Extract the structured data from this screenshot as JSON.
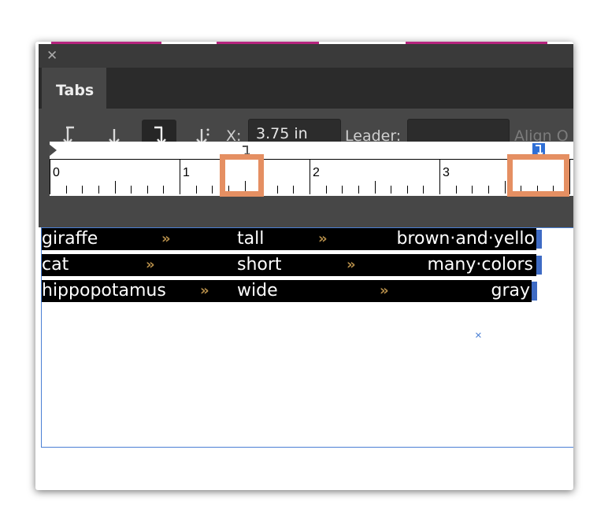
{
  "panel": {
    "title_tab": "Tabs",
    "close_icon": "close-icon",
    "toolbar": {
      "buttons": [
        {
          "name": "left-justified-tab-icon",
          "glyph": "↓"
        },
        {
          "name": "center-justified-tab-icon",
          "glyph": "↓"
        },
        {
          "name": "right-justified-tab-icon",
          "glyph": "↓"
        },
        {
          "name": "align-to-decimal-tab-icon",
          "glyph": "↓"
        }
      ],
      "x_label": "X:",
      "x_value": "3.75 in",
      "leader_label": "Leader:",
      "leader_value": "",
      "align_label": "Align O"
    },
    "ruler": {
      "numbers": [
        "0",
        "1",
        "2",
        "3"
      ]
    }
  },
  "document": {
    "rows": [
      {
        "col1": "giraffe",
        "col2": "tall",
        "col3": "brown·and·yello"
      },
      {
        "col1": "cat",
        "col2": "short",
        "col3": "many·colors"
      },
      {
        "col1": "hippopotamus",
        "col2": "wide",
        "col3": "gray"
      }
    ],
    "tab_marker": "»",
    "cursor_mark": "×"
  },
  "colors": {
    "panel_bg": "#474747",
    "highlight": "#e58f62",
    "accent_blue": "#3e6bc4",
    "tab_arrow": "#b28b48"
  }
}
